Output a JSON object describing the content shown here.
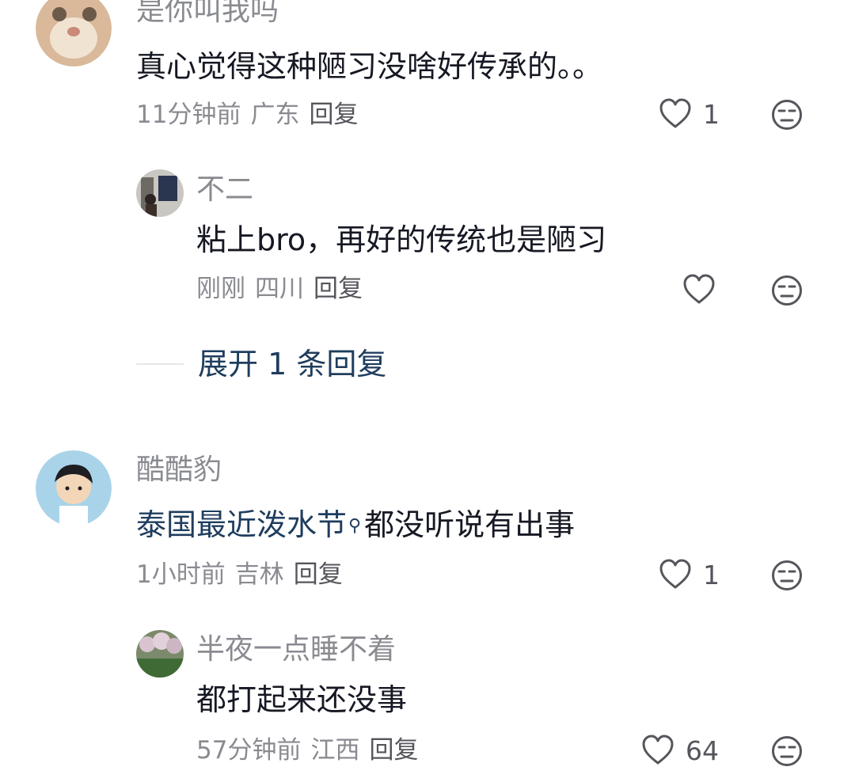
{
  "comments": [
    {
      "username": "是你叫我吗",
      "text": "真心觉得这种陋习没啥好传承的。。",
      "time": "11分钟前",
      "location": "广东",
      "reply_label": "回复",
      "like_count": "1"
    },
    {
      "username": "不二",
      "text": "粘上bro，再好的传统也是陋习",
      "time": "刚刚",
      "location": "四川",
      "reply_label": "回复",
      "like_count": ""
    },
    {
      "username": "酷酷豹",
      "text_link": "泰国最近泼水节",
      "text_rest": "都没听说有出事",
      "time": "1小时前",
      "location": "吉林",
      "reply_label": "回复",
      "like_count": "1"
    },
    {
      "username": "半夜一点睡不着",
      "text": "都打起来还没事",
      "time": "57分钟前",
      "location": "江西",
      "reply_label": "回复",
      "like_count": "64"
    }
  ],
  "expand_replies": "展开 1 条回复",
  "icons": {
    "like": "heart-outline-icon",
    "dislike": "unamused-face-icon",
    "search_hint": "search-icon"
  },
  "colors": {
    "link": "#1f3d5e",
    "meta": "#8a8b91",
    "text": "#161823"
  }
}
